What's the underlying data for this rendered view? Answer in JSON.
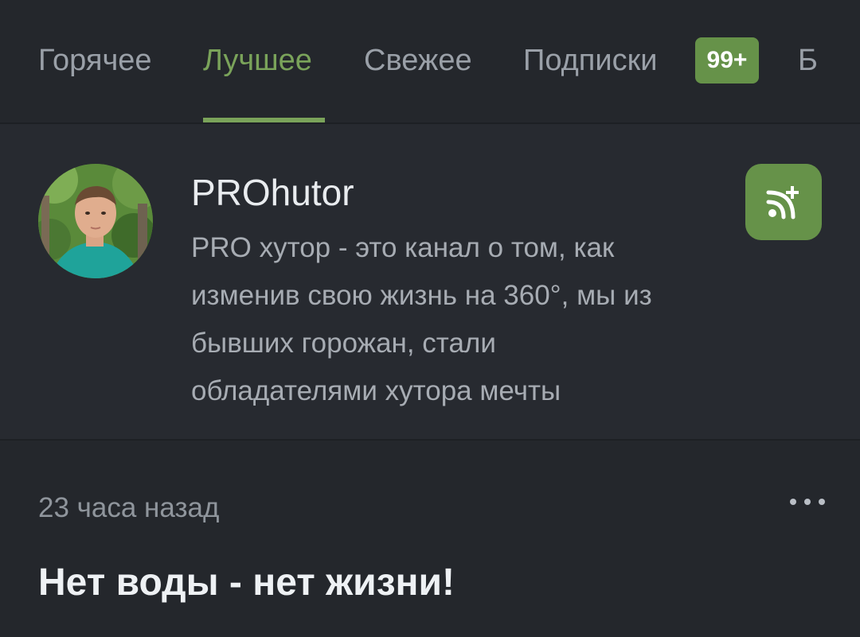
{
  "tabs": [
    {
      "label": "Горячее",
      "active": false
    },
    {
      "label": "Лучшее",
      "active": true
    },
    {
      "label": "Свежее",
      "active": false
    },
    {
      "label": "Подписки",
      "active": false
    },
    {
      "label": "Б",
      "active": false
    }
  ],
  "subscriptions_badge": "99+",
  "channel": {
    "name": "PROhutor",
    "description_lines": [
      "PRO хутор - это канал о том, как",
      "изменив свою жизнь на 360°, мы из",
      "бывших горожан, стали",
      "обладателями хутора мечты"
    ],
    "avatar_icon": "user-avatar-photo",
    "subscribe_icon": "rss-plus-icon"
  },
  "post": {
    "time": "23 часа назад",
    "title": "Нет воды - нет жизни!",
    "more_icon": "more-dots-icon"
  },
  "colors": {
    "background": "#24272c",
    "accent": "#7aa35a",
    "button_green": "#669249",
    "text_primary": "#e9ecef",
    "text_secondary": "#a7acb3"
  }
}
